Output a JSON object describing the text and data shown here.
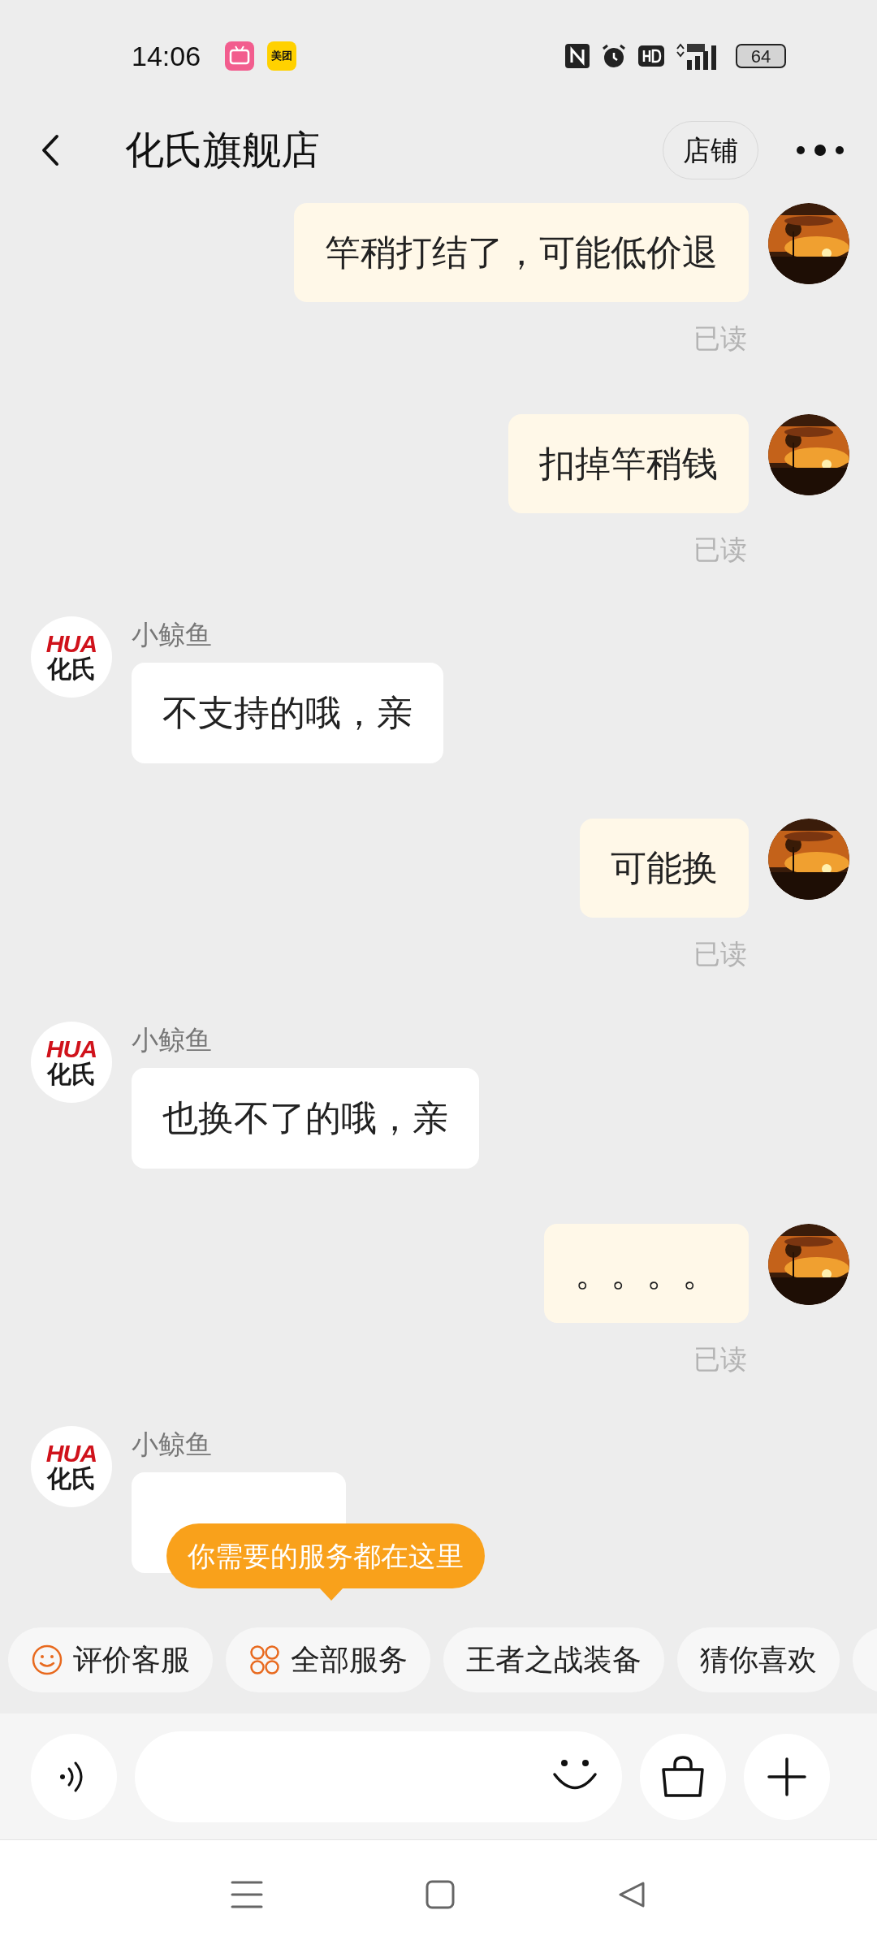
{
  "status_bar": {
    "time": "14:06",
    "app_icons": [
      {
        "kind": "bilibili"
      },
      {
        "kind": "meituan",
        "label": "美团"
      }
    ],
    "battery": "64"
  },
  "header": {
    "title": "化氏旗舰店",
    "shop_button": "店铺"
  },
  "messages": [
    {
      "kind": "sent",
      "text": "竿稍打结了，可能低价退",
      "receipt": "已读"
    },
    {
      "kind": "sent",
      "text": "扣掉竿稍钱",
      "receipt": "已读"
    },
    {
      "kind": "received",
      "sender": "小鲸鱼",
      "avatar_text": [
        "HUA",
        "化氏"
      ],
      "text": "不支持的哦，亲"
    },
    {
      "kind": "sent",
      "text": "可能换",
      "receipt": "已读"
    },
    {
      "kind": "received",
      "sender": "小鲸鱼",
      "avatar_text": [
        "HUA",
        "化氏"
      ],
      "text": "也换不了的哦，亲"
    },
    {
      "kind": "sent",
      "text": "。。。。",
      "receipt": "已读"
    },
    {
      "kind": "received",
      "sender": "小鲸鱼",
      "avatar_text": [
        "HUA",
        "化氏"
      ]
    }
  ],
  "tooltip": "你需要的服务都在这里",
  "quick_chips": [
    {
      "kind": "rating",
      "label": "评价客服"
    },
    {
      "kind": "services",
      "label": "全部服务"
    },
    {
      "kind": "plain",
      "label": "王者之战装备"
    },
    {
      "kind": "plain",
      "label": "猜你喜欢"
    },
    {
      "kind": "partial"
    }
  ]
}
